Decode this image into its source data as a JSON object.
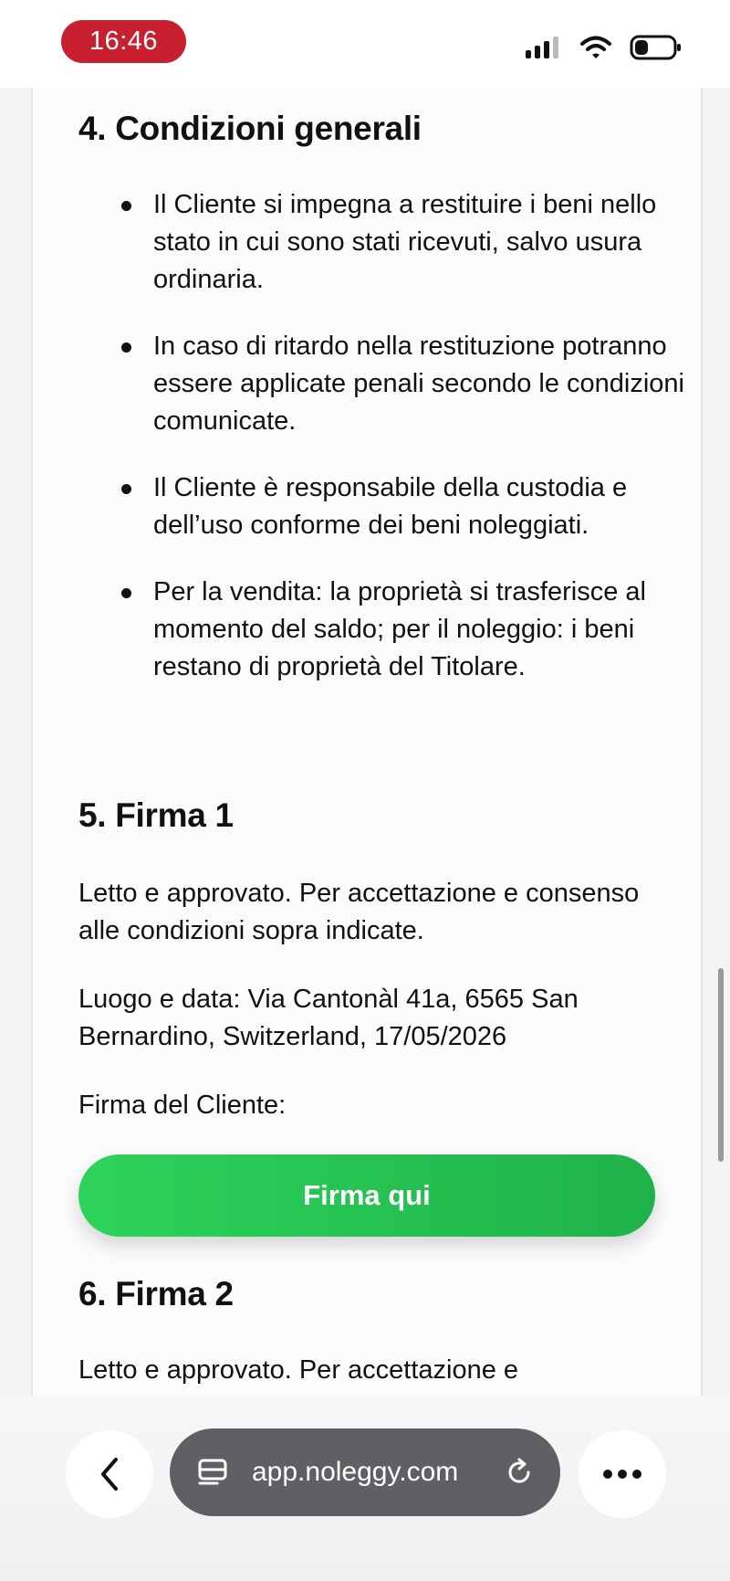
{
  "status_bar": {
    "time": "16:46",
    "icons": [
      "signal-icon",
      "wifi-icon",
      "battery-icon"
    ],
    "time_pill_color": "#c8202f"
  },
  "document": {
    "section4": {
      "title": "4. Condizioni generali",
      "items": [
        "Il Cliente si impegna a restituire i beni nello stato in cui sono stati ricevuti, salvo usura ordinaria.",
        "In caso di ritardo nella restituzione potranno essere applicate penali secondo le condizioni comunicate.",
        "Il Cliente è responsabile della custodia e dell’uso conforme dei beni noleggiati.",
        "Per la vendita: la proprietà si trasferisce al momento del saldo; per il noleggio: i beni restano di proprietà del Titolare."
      ]
    },
    "section5": {
      "title": "5. Firma 1",
      "approval": "Letto e approvato. Per accettazione e consenso alle condizioni sopra indicate.",
      "place_date": "Luogo e data: Via Cantonàl 41a, 6565 San Bernardino, Switzerland, 17/05/2026",
      "signature_label": "Firma del Cliente:",
      "sign_button": "Firma qui"
    },
    "section6": {
      "title": "6. Firma 2",
      "approval": "Letto e approvato. Per accettazione e"
    }
  },
  "browser_bar": {
    "url": "app.noleggy.com",
    "icons": [
      "back-icon",
      "tabs-icon",
      "reload-icon",
      "more-icon"
    ]
  },
  "colors": {
    "sign_button": "#2dd35a",
    "url_pill": "#5f6063"
  }
}
